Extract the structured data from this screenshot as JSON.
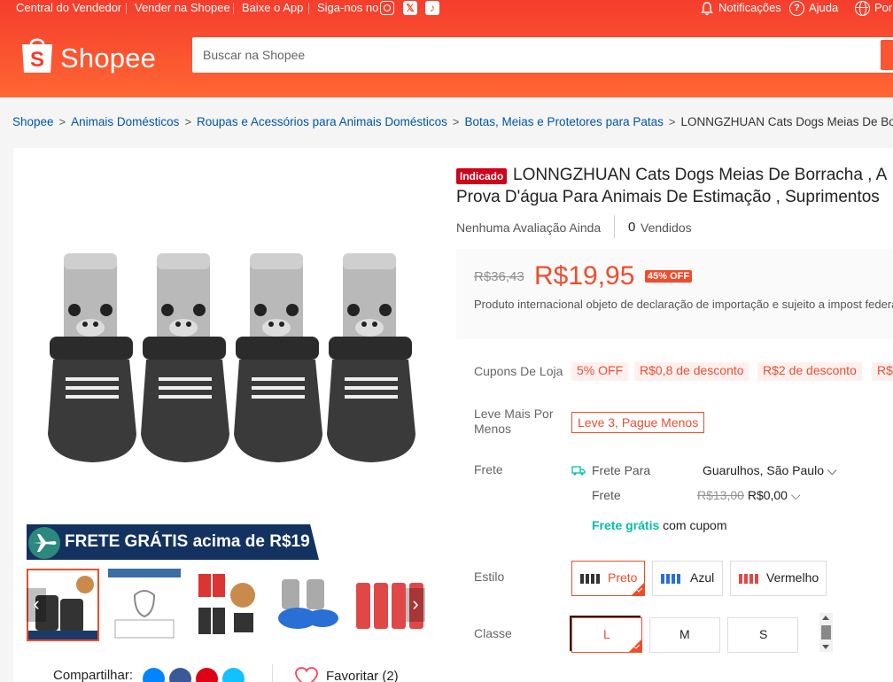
{
  "topbar": {
    "seller_center": "Central do Vendedor",
    "sell": "Vender na Shopee",
    "download": "Baixe o App",
    "follow": "Siga-nos no",
    "notifications": "Notificações",
    "help": "Ajuda",
    "language": "Por"
  },
  "logo": {
    "text": "Shopee"
  },
  "search": {
    "placeholder": "Buscar na Shopee"
  },
  "breadcrumb": {
    "items": [
      "Shopee",
      "Animais Domésticos",
      "Roupas e Acessórios para Animais Domésticos",
      "Botas, Meias e Protetores para Patas"
    ],
    "current": "LONNGZHUAN Cats Dogs Meias De Borrac"
  },
  "gallery": {
    "banner_text": "FRETE GRÁTIS acima de R$19",
    "share_label": "Compartilhar:",
    "favorite_label": "Favoritar (2)"
  },
  "product": {
    "badge": "Indicado",
    "title_line1": "LONNGZHUAN Cats Dogs Meias De Borracha , A",
    "title_line2": "Prova D'água Para Animais De Estimação , Suprimentos",
    "rating_text": "Nenhuma Avaliação Ainda",
    "sold_count": "0",
    "sold_label": "Vendidos"
  },
  "price": {
    "original": "R$36,43",
    "current": "R$19,95",
    "discount": "45% OFF",
    "import_note": "Produto internacional objeto de declaração de importação e sujeito a impost federais"
  },
  "coupons": {
    "label": "Cupons De Loja",
    "items": [
      "5% OFF",
      "R$0,8 de desconto",
      "R$2 de desconto",
      "R$"
    ]
  },
  "deal": {
    "label": "Leve Mais Por Menos",
    "value": "Leve 3, Pague Menos"
  },
  "shipping": {
    "label": "Frete",
    "to_label": "Frete Para",
    "destination": "Guarulhos, São Paulo",
    "fee_label": "Frete",
    "fee_old": "R$13,00",
    "fee_new": "R$0,00",
    "free_highlight": "Frete grátis",
    "free_suffix": "com cupom"
  },
  "style": {
    "label": "Estilo",
    "options": [
      "Preto",
      "Azul",
      "Vermelho"
    ],
    "selected": "Preto"
  },
  "size": {
    "label": "Classe",
    "options": [
      "L",
      "M",
      "S"
    ],
    "selected": "L"
  },
  "colors": {
    "brand": "#ee4d2d",
    "header_top": "#f53d2d",
    "header_bottom": "#ff6633",
    "link": "#0055aa",
    "banner": "#14325f",
    "free_ship_green": "#00bfa5"
  }
}
